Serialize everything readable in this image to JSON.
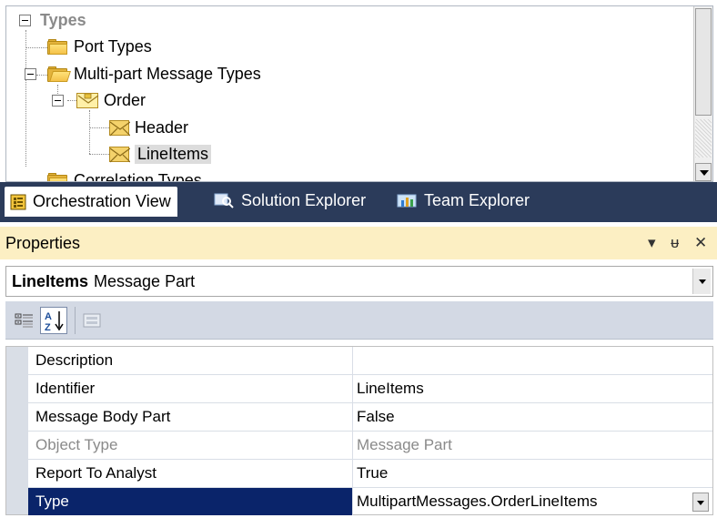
{
  "tree": {
    "items": [
      {
        "label": "Types",
        "icon": "minus-expander-icon"
      },
      {
        "label": "Port Types",
        "icon": "folder-icon"
      },
      {
        "label": "Multi-part Message Types",
        "icon": "open-folder-icon"
      },
      {
        "label": "Order",
        "icon": "multipart-message-icon"
      },
      {
        "label": "Header",
        "icon": "message-part-icon"
      },
      {
        "label": "LineItems",
        "icon": "message-part-icon",
        "selected": true
      },
      {
        "label": "Correlation Types",
        "icon": "folder-icon"
      }
    ]
  },
  "tabs": [
    {
      "label": "Orchestration View",
      "active": true,
      "icon": "orchestration-view-icon"
    },
    {
      "label": "Solution Explorer",
      "active": false,
      "icon": "solution-explorer-icon"
    },
    {
      "label": "Team Explorer",
      "active": false,
      "icon": "team-explorer-icon"
    }
  ],
  "properties": {
    "title": "Properties",
    "header_controls": {
      "dropdown": "▾",
      "pin": "ᵾ",
      "close": "✕"
    },
    "object_selector": {
      "name": "LineItems",
      "type": "Message Part"
    },
    "toolbar": {
      "categorized": "categorized-icon",
      "alphabetical": "alphabetical-sort-icon",
      "property_pages": "property-pages-icon"
    },
    "rows": [
      {
        "name": "Description",
        "value": ""
      },
      {
        "name": "Identifier",
        "value": "LineItems"
      },
      {
        "name": "Message Body Part",
        "value": "False"
      },
      {
        "name": "Object Type",
        "value": "Message Part",
        "disabled": true
      },
      {
        "name": "Report To Analyst",
        "value": "True"
      },
      {
        "name": "Type",
        "value": "MultipartMessages.OrderLineItems",
        "selected": true
      }
    ]
  },
  "colors": {
    "tab_strip_bg": "#2b3b5a",
    "properties_header_bg": "#fcefc3",
    "selected_row_bg": "#0a246a",
    "toolbar_bg": "#d3d9e4"
  }
}
